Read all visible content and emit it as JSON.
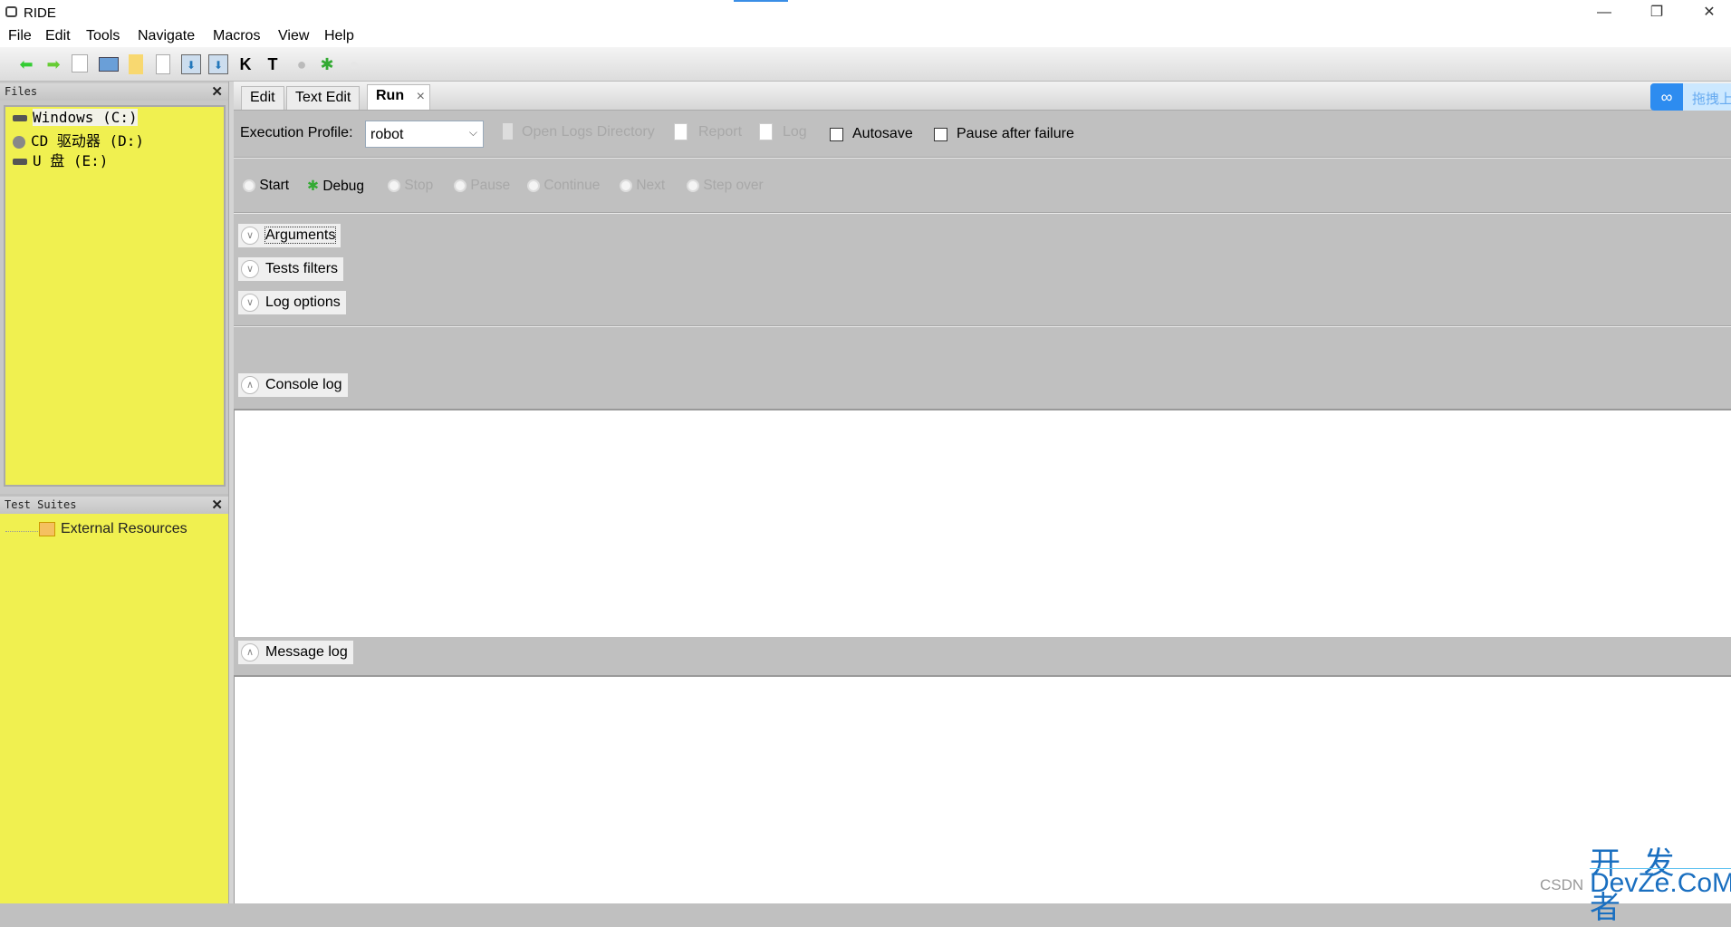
{
  "window": {
    "title": "RIDE",
    "controls": [
      "minimize",
      "restore",
      "close"
    ]
  },
  "menu": [
    "File",
    "Edit",
    "Tools",
    "Navigate",
    "Macros",
    "View",
    "Help"
  ],
  "toolbar": {
    "icons": [
      "back-icon",
      "forward-icon",
      "new-project-icon",
      "open-icon",
      "open-directory-icon",
      "new-file-icon",
      "save-icon",
      "save-all-icon",
      "search-keywords-icon",
      "search-tests-icon",
      "run-icon",
      "debug-icon",
      "stop-icon"
    ]
  },
  "files_panel": {
    "title": "Files",
    "items": [
      "Windows (C:)",
      "CD 驱动器 (D:)",
      "U 盘 (E:)"
    ]
  },
  "suites_panel": {
    "title": "Test Suites",
    "items": [
      "External Resources"
    ]
  },
  "tabs": [
    {
      "label": "Edit"
    },
    {
      "label": "Text Edit"
    },
    {
      "label": "Run",
      "active": true
    }
  ],
  "run": {
    "profile_label": "Execution Profile:",
    "profile_value": "robot",
    "open_logs": "Open Logs Directory",
    "report": "Report",
    "log": "Log",
    "autosave": "Autosave",
    "autosave_checked": false,
    "pause_after_failure": "Pause after failure",
    "pause_checked": false,
    "buttons": {
      "start": "Start",
      "debug": "Debug",
      "stop": "Stop",
      "pause": "Pause",
      "continue": "Continue",
      "next": "Next",
      "step_over": "Step over"
    },
    "sections": {
      "arguments": "Arguments",
      "tests_filters": "Tests filters",
      "log_options": "Log options",
      "console_log": "Console log",
      "message_log": "Message log"
    }
  },
  "overlay": {
    "label": "拖拽上"
  },
  "watermark": {
    "line1": "开 发 者",
    "line2": "DevZe.CoM",
    "csdn": "CSDN"
  }
}
